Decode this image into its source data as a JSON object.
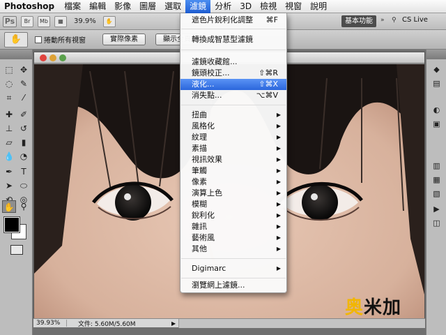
{
  "menubar": {
    "app": "Photoshop",
    "items": [
      "檔案",
      "編輯",
      "影像",
      "圖層",
      "選取",
      "濾鏡",
      "分析",
      "3D",
      "檢視",
      "視窗",
      "說明"
    ],
    "active_index": 5
  },
  "appbar": {
    "logo": "Ps",
    "btn_br": "Br",
    "btn_mb": "Mb",
    "zoom": "39.9%",
    "workspace": "基本功能",
    "cs_live": "CS Live",
    "fastforward": "»"
  },
  "optbar": {
    "checkbox_label": "捲動所有視窗",
    "btn_actual_pixels": "實際像素",
    "btn_fit_screen": "顯示全頁"
  },
  "status": {
    "zoom": "39.93%",
    "doc": "文件: 5.60M/5.60M"
  },
  "filter_menu": {
    "items": [
      {
        "label": "遮色片銳利化調整",
        "shortcut": "⌘F"
      },
      {
        "label": "轉換成智慧型濾鏡",
        "shortcut": ""
      },
      {
        "label": "濾鏡收藏館...",
        "shortcut": ""
      },
      {
        "label": "鏡頭校正...",
        "shortcut": "⇧⌘R"
      },
      {
        "label": "液化...",
        "shortcut": "⇧⌘X"
      },
      {
        "label": "消失點...",
        "shortcut": "⌥⌘V"
      },
      {
        "label": "扭曲",
        "submenu": true
      },
      {
        "label": "風格化",
        "submenu": true
      },
      {
        "label": "紋理",
        "submenu": true
      },
      {
        "label": "素描",
        "submenu": true
      },
      {
        "label": "視訊效果",
        "submenu": true
      },
      {
        "label": "筆觸",
        "submenu": true
      },
      {
        "label": "像素",
        "submenu": true
      },
      {
        "label": "演算上色",
        "submenu": true
      },
      {
        "label": "模糊",
        "submenu": true
      },
      {
        "label": "銳利化",
        "submenu": true
      },
      {
        "label": "雜訊",
        "submenu": true
      },
      {
        "label": "藝術風",
        "submenu": true
      },
      {
        "label": "其他",
        "submenu": true
      },
      {
        "label": "Digimarc",
        "submenu": true
      },
      {
        "label": "瀏覽網上濾鏡...",
        "shortcut": ""
      }
    ],
    "highlighted_index": 4
  },
  "watermark": {
    "part1": "奥",
    "part2": "米加"
  }
}
